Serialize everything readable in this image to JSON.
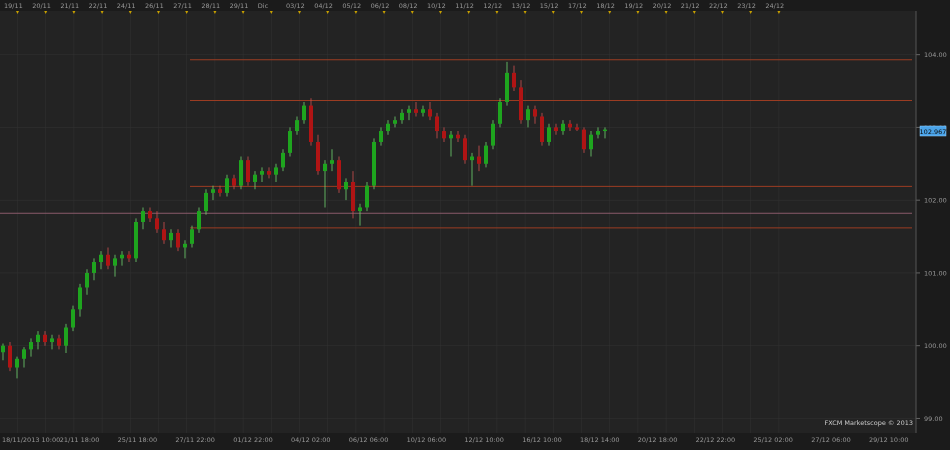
{
  "watermark": "FXCM Marketscope © 2013",
  "colors": {
    "background": "#1b1b1b",
    "plot": "#232323",
    "grid": "#333333",
    "text": "#9a9a9a",
    "up": "#1ea51e",
    "down": "#b01414",
    "level": "#9b3c22",
    "pink_level": "#8a5a6a",
    "price_tag": "#4aa3e8",
    "marker": "#c8a000"
  },
  "chart_data": {
    "type": "candlestick",
    "y_axis": {
      "min": 98.8,
      "max": 104.6,
      "ticks": [
        "104.00",
        "103.00",
        "102.00",
        "101.00",
        "100.00",
        "99.00"
      ]
    },
    "last_price": "102.967",
    "top_axis_labels": [
      "19/11",
      "20/11",
      "21/11",
      "22/11",
      "24/11",
      "26/11",
      "27/11",
      "28/11",
      "29/11",
      "Dic",
      "03/12",
      "04/12",
      "05/12",
      "06/12",
      "08/12",
      "10/12",
      "11/12",
      "12/12",
      "13/12",
      "15/12",
      "17/12",
      "18/12",
      "19/12",
      "20/12",
      "21/12",
      "22/12",
      "23/12",
      "24/12"
    ],
    "bottom_axis_labels": [
      "18/11/2013 10:00",
      "21/11 18:00",
      "25/11 18:00",
      "27/11 22:00",
      "01/12 22:00",
      "04/12 02:00",
      "06/12 06:00",
      "10/12 06:00",
      "12/12 10:00",
      "16/12 10:00",
      "18/12 14:00",
      "20/12 18:00",
      "22/12 22:00",
      "25/12 02:00",
      "27/12 06:00",
      "29/12 10:00"
    ],
    "horizontal_levels": [
      103.93,
      103.37,
      102.19,
      101.82,
      101.62
    ],
    "candles": [
      [
        99.91,
        100.03,
        99.8,
        100.0
      ],
      [
        100.0,
        100.05,
        99.65,
        99.7
      ],
      [
        99.7,
        99.85,
        99.55,
        99.82
      ],
      [
        99.82,
        99.98,
        99.7,
        99.95
      ],
      [
        99.95,
        100.1,
        99.85,
        100.05
      ],
      [
        100.05,
        100.2,
        99.95,
        100.15
      ],
      [
        100.15,
        100.2,
        100.0,
        100.05
      ],
      [
        100.05,
        100.15,
        99.95,
        100.1
      ],
      [
        100.1,
        100.15,
        99.95,
        100.0
      ],
      [
        100.0,
        100.3,
        99.9,
        100.25
      ],
      [
        100.25,
        100.55,
        100.2,
        100.5
      ],
      [
        100.5,
        100.85,
        100.4,
        100.8
      ],
      [
        100.8,
        101.05,
        100.7,
        101.0
      ],
      [
        101.0,
        101.2,
        100.9,
        101.15
      ],
      [
        101.15,
        101.3,
        101.05,
        101.25
      ],
      [
        101.25,
        101.35,
        101.05,
        101.1
      ],
      [
        101.1,
        101.25,
        100.95,
        101.2
      ],
      [
        101.2,
        101.3,
        101.1,
        101.25
      ],
      [
        101.25,
        101.3,
        101.15,
        101.2
      ],
      [
        101.2,
        101.75,
        101.15,
        101.7
      ],
      [
        101.7,
        101.9,
        101.6,
        101.85
      ],
      [
        101.85,
        101.9,
        101.7,
        101.75
      ],
      [
        101.75,
        101.85,
        101.55,
        101.6
      ],
      [
        101.6,
        101.7,
        101.4,
        101.45
      ],
      [
        101.45,
        101.6,
        101.35,
        101.55
      ],
      [
        101.55,
        101.6,
        101.3,
        101.35
      ],
      [
        101.35,
        101.45,
        101.2,
        101.4
      ],
      [
        101.4,
        101.65,
        101.35,
        101.6
      ],
      [
        101.6,
        101.9,
        101.55,
        101.85
      ],
      [
        101.85,
        102.15,
        101.8,
        102.1
      ],
      [
        102.1,
        102.2,
        102.0,
        102.15
      ],
      [
        102.15,
        102.2,
        102.05,
        102.1
      ],
      [
        102.1,
        102.35,
        102.05,
        102.3
      ],
      [
        102.3,
        102.35,
        102.15,
        102.2
      ],
      [
        102.2,
        102.6,
        102.15,
        102.55
      ],
      [
        102.55,
        102.6,
        102.2,
        102.25
      ],
      [
        102.25,
        102.4,
        102.15,
        102.35
      ],
      [
        102.35,
        102.45,
        102.25,
        102.4
      ],
      [
        102.4,
        102.45,
        102.3,
        102.35
      ],
      [
        102.35,
        102.5,
        102.25,
        102.45
      ],
      [
        102.45,
        102.7,
        102.4,
        102.65
      ],
      [
        102.65,
        103.0,
        102.6,
        102.95
      ],
      [
        102.95,
        103.15,
        102.9,
        103.1
      ],
      [
        103.1,
        103.35,
        103.05,
        103.3
      ],
      [
        103.3,
        103.4,
        102.75,
        102.8
      ],
      [
        102.8,
        102.9,
        102.35,
        102.4
      ],
      [
        102.4,
        102.55,
        101.9,
        102.5
      ],
      [
        102.5,
        102.7,
        102.4,
        102.55
      ],
      [
        102.55,
        102.6,
        102.1,
        102.15
      ],
      [
        102.15,
        102.3,
        102.0,
        102.25
      ],
      [
        102.25,
        102.4,
        101.75,
        101.85
      ],
      [
        101.85,
        101.95,
        101.65,
        101.9
      ],
      [
        101.9,
        102.25,
        101.85,
        102.2
      ],
      [
        102.2,
        102.85,
        102.15,
        102.8
      ],
      [
        102.8,
        103.0,
        102.75,
        102.95
      ],
      [
        102.95,
        103.1,
        102.9,
        103.05
      ],
      [
        103.05,
        103.15,
        103.0,
        103.1
      ],
      [
        103.1,
        103.25,
        103.05,
        103.2
      ],
      [
        103.2,
        103.3,
        103.1,
        103.25
      ],
      [
        103.25,
        103.35,
        103.15,
        103.2
      ],
      [
        103.2,
        103.3,
        103.15,
        103.25
      ],
      [
        103.25,
        103.35,
        103.1,
        103.15
      ],
      [
        103.15,
        103.2,
        102.85,
        102.95
      ],
      [
        102.95,
        103.0,
        102.8,
        102.85
      ],
      [
        102.85,
        102.95,
        102.6,
        102.9
      ],
      [
        102.9,
        102.95,
        102.8,
        102.85
      ],
      [
        102.85,
        102.9,
        102.5,
        102.55
      ],
      [
        102.55,
        102.65,
        102.2,
        102.6
      ],
      [
        102.6,
        102.75,
        102.4,
        102.5
      ],
      [
        102.5,
        102.8,
        102.45,
        102.75
      ],
      [
        102.75,
        103.1,
        102.7,
        103.05
      ],
      [
        103.05,
        103.4,
        103.0,
        103.35
      ],
      [
        103.35,
        103.9,
        103.3,
        103.75
      ],
      [
        103.75,
        103.85,
        103.5,
        103.55
      ],
      [
        103.55,
        103.65,
        103.05,
        103.1
      ],
      [
        103.1,
        103.3,
        103.0,
        103.25
      ],
      [
        103.25,
        103.3,
        103.05,
        103.15
      ],
      [
        103.15,
        103.2,
        102.75,
        102.8
      ],
      [
        102.8,
        103.05,
        102.75,
        103.0
      ],
      [
        103.0,
        103.05,
        102.9,
        102.95
      ],
      [
        102.95,
        103.1,
        102.9,
        103.05
      ],
      [
        103.05,
        103.1,
        102.95,
        103.0
      ],
      [
        103.0,
        103.05,
        102.95,
        102.97
      ],
      [
        102.97,
        103.0,
        102.65,
        102.7
      ],
      [
        102.7,
        102.95,
        102.6,
        102.9
      ],
      [
        102.9,
        103.0,
        102.85,
        102.95
      ],
      [
        102.95,
        103.0,
        102.85,
        102.97
      ]
    ]
  }
}
